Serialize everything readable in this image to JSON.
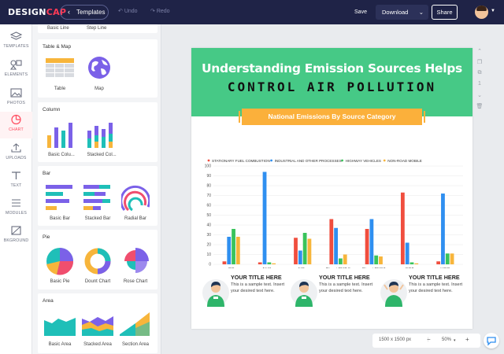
{
  "app": {
    "logo_a": "DESIGN",
    "logo_b": "CAP"
  },
  "toolbar": {
    "templates": "Templates",
    "undo": "Undo",
    "redo": "Redo",
    "save": "Save",
    "download": "Download",
    "share": "Share"
  },
  "sidebar": [
    {
      "label": "TEMPLATES",
      "icon": "layers-icon"
    },
    {
      "label": "ELEMENTS",
      "icon": "shapes-icon"
    },
    {
      "label": "PHOTOS",
      "icon": "photo-icon"
    },
    {
      "label": "CHART",
      "icon": "pie-chart-icon",
      "active": true
    },
    {
      "label": "UPLOADS",
      "icon": "upload-icon"
    },
    {
      "label": "TEXT",
      "icon": "text-icon"
    },
    {
      "label": "MODULES",
      "icon": "list-icon"
    },
    {
      "label": "BKGROUND",
      "icon": "background-icon"
    }
  ],
  "panel": {
    "top_labels": [
      "Basic Line",
      "Step Line"
    ],
    "sections": [
      {
        "title": "Table & Map",
        "items": [
          "Table",
          "Map"
        ]
      },
      {
        "title": "Column",
        "items": [
          "Basic Colu...",
          "Stacked Col..."
        ]
      },
      {
        "title": "Bar",
        "items": [
          "Basic Bar",
          "Stacked Bar",
          "Radial Bar"
        ]
      },
      {
        "title": "Pie",
        "items": [
          "Basic Pie",
          "Dount Chart",
          "Rose Chart"
        ]
      },
      {
        "title": "Area",
        "items": [
          "Basic Area",
          "Stacked Area",
          "Section Area"
        ]
      }
    ]
  },
  "design": {
    "title_line1": "Understanding Emission Sources Helps",
    "title_line2": "CONTROL AIR POLLUTION",
    "subtitle": "National Emissions By Source Category",
    "cards": [
      {
        "title": "YOUR TITLE HERE",
        "text": "This is a sample text. Insert your desired text here."
      },
      {
        "title": "YOUR TITLE HERE",
        "text": "This is a sample text. Insert your desired text here."
      },
      {
        "title": "YOUR TITLE HERE",
        "text": "This is a sample text. Insert your desired text here."
      }
    ]
  },
  "chart_data": {
    "type": "bar",
    "categories": [
      "CO",
      "NH3",
      "NOx",
      "Direct PM2.5",
      "Direct PM10",
      "SO2",
      "VOC"
    ],
    "series": [
      {
        "name": "STATIONARY FUEL COMBUSTION",
        "color": "#f04e3e",
        "values": [
          3,
          2,
          27,
          46,
          36,
          73,
          3
        ]
      },
      {
        "name": "INDUSTRIAL AND OTHER PROCESSES",
        "color": "#2f8ff0",
        "values": [
          28,
          94,
          14,
          37,
          46,
          22,
          72
        ]
      },
      {
        "name": "HIGHWAY VEHICLES",
        "color": "#39c35b",
        "values": [
          36,
          2,
          32,
          6,
          9,
          2,
          11
        ]
      },
      {
        "name": "NON-ROAD MOBILE",
        "color": "#f7b53b",
        "values": [
          28,
          1,
          26,
          10,
          8,
          1,
          11
        ]
      }
    ],
    "yticks": [
      0,
      10,
      20,
      30,
      40,
      50,
      60,
      70,
      80,
      90,
      100
    ],
    "ylim": [
      0,
      100
    ],
    "legend": "top",
    "grid": true
  },
  "minitools": [
    "up-icon",
    "copy-icon",
    "duplicate-icon",
    "1",
    "down-icon",
    "delete-icon"
  ],
  "statusbar": {
    "size": "1500 x 1500 px",
    "zoom": "50%",
    "minus": "−",
    "plus": "+"
  }
}
